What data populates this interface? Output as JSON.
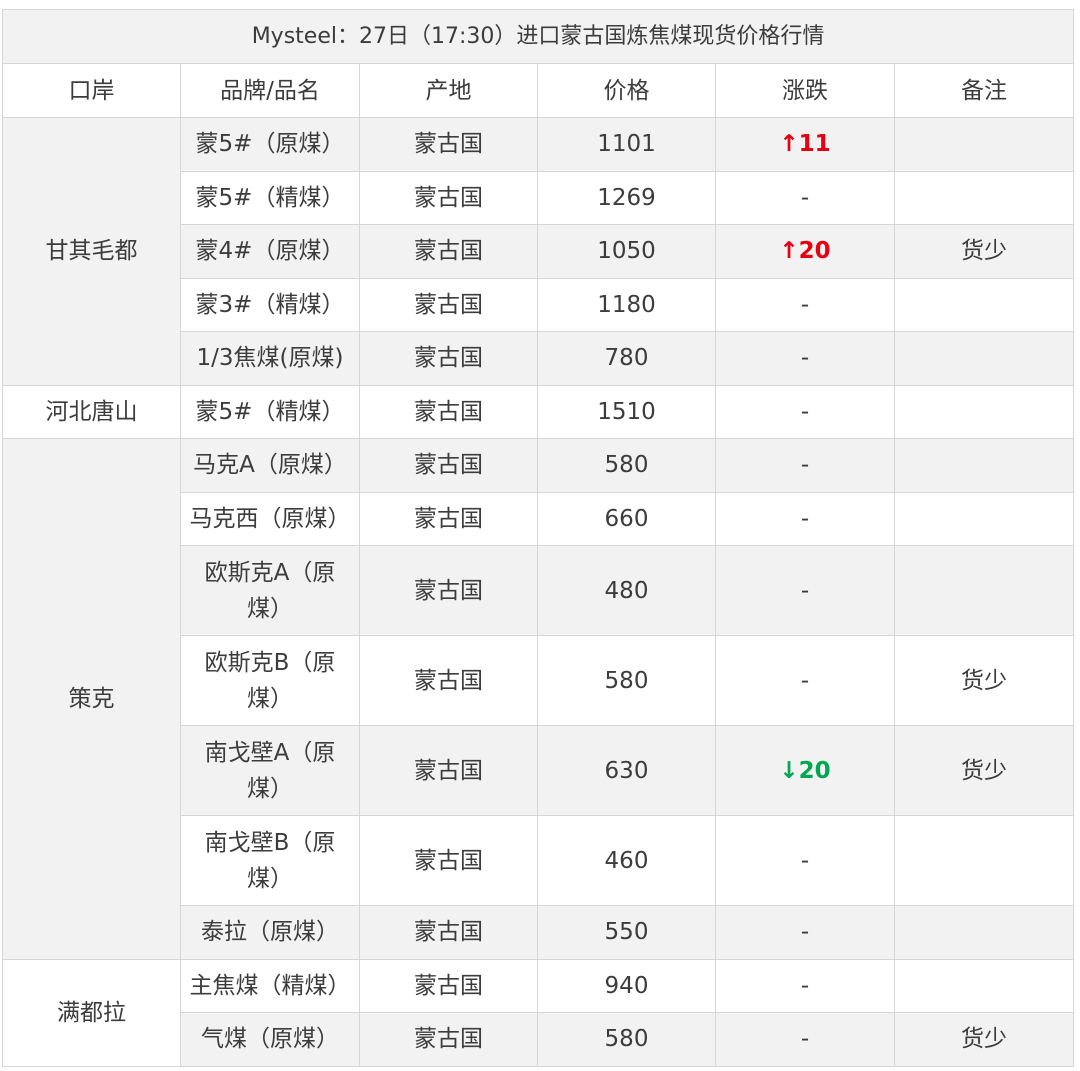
{
  "title": "Mysteel：27日（17:30）进口蒙古国炼焦煤现货价格行情",
  "headers": [
    "口岸",
    "品牌/品名",
    "产地",
    "价格",
    "涨跌",
    "备注"
  ],
  "ports": {
    "p1": "甘其毛都",
    "p2": "河北唐山",
    "p3": "策克",
    "p4": "满都拉"
  },
  "rows": [
    {
      "brand": "蒙5#（原煤）",
      "origin": "蒙古国",
      "price": "1101",
      "change": "↑11",
      "note": ""
    },
    {
      "brand": "蒙5#（精煤）",
      "origin": "蒙古国",
      "price": "1269",
      "change": "-",
      "note": ""
    },
    {
      "brand": "蒙4#（原煤）",
      "origin": "蒙古国",
      "price": "1050",
      "change": "↑20",
      "note": "货少"
    },
    {
      "brand": "蒙3#（精煤）",
      "origin": "蒙古国",
      "price": "1180",
      "change": "-",
      "note": ""
    },
    {
      "brand": "1/3焦煤(原煤)",
      "origin": "蒙古国",
      "price": "780",
      "change": "-",
      "note": ""
    },
    {
      "brand": "蒙5#（精煤）",
      "origin": "蒙古国",
      "price": "1510",
      "change": "-",
      "note": ""
    },
    {
      "brand": "马克A（原煤）",
      "origin": "蒙古国",
      "price": "580",
      "change": "-",
      "note": ""
    },
    {
      "brand": "马克西（原煤）",
      "origin": "蒙古国",
      "price": "660",
      "change": "-",
      "note": ""
    },
    {
      "brand": "欧斯克A（原煤）",
      "origin": "蒙古国",
      "price": "480",
      "change": "-",
      "note": ""
    },
    {
      "brand": "欧斯克B（原煤）",
      "origin": "蒙古国",
      "price": "580",
      "change": "-",
      "note": "货少"
    },
    {
      "brand": "南戈壁A（原煤）",
      "origin": "蒙古国",
      "price": "630",
      "change": "↓20",
      "note": "货少"
    },
    {
      "brand": "南戈壁B（原煤）",
      "origin": "蒙古国",
      "price": "460",
      "change": "-",
      "note": ""
    },
    {
      "brand": "泰拉（原煤）",
      "origin": "蒙古国",
      "price": "550",
      "change": "-",
      "note": ""
    },
    {
      "brand": "主焦煤（精煤）",
      "origin": "蒙古国",
      "price": "940",
      "change": "-",
      "note": ""
    },
    {
      "brand": "气煤（原煤）",
      "origin": "蒙古国",
      "price": "580",
      "change": "-",
      "note": "货少"
    }
  ],
  "colors": {
    "up": "#e60012",
    "down": "#00a651",
    "shade": "#f2f2f2",
    "border": "#d6d6d6"
  }
}
